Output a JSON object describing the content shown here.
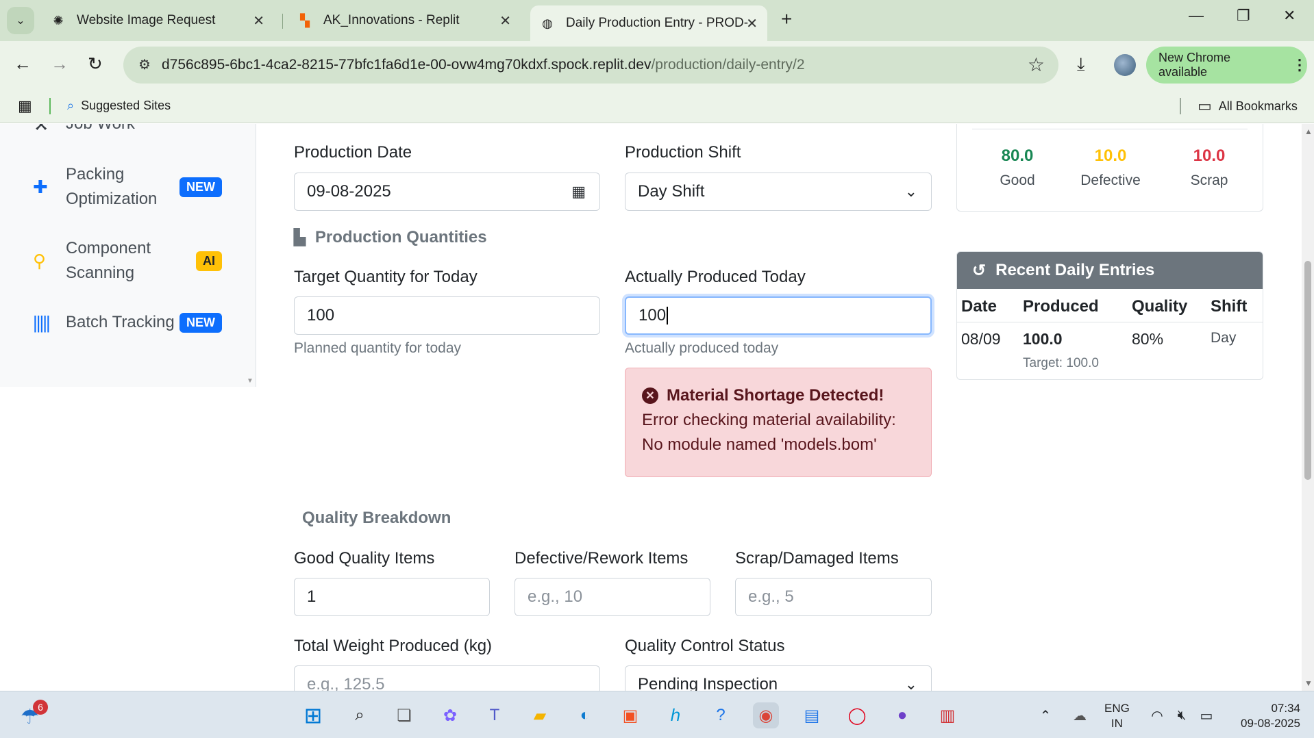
{
  "browser": {
    "tabs": [
      {
        "title": "Website Image Request",
        "favicon": "openai-icon"
      },
      {
        "title": "AK_Innovations - Replit",
        "favicon": "replit-icon"
      },
      {
        "title": "Daily Production Entry - PROD-",
        "favicon": "globe-icon"
      }
    ],
    "url_host": "d756c895-6bc1-4ca2-8215-77bfc1fa6d1e-00-ovw4mg70kdxf.spock.replit.dev",
    "url_path": "/production/daily-entry/2",
    "new_chrome": "New Chrome available",
    "bookmarks": {
      "suggested": "Suggested Sites",
      "all": "All Bookmarks"
    }
  },
  "sidebar": {
    "items": [
      {
        "label": "Job Work",
        "icon": "tools-icon"
      },
      {
        "label": "Packing Optimization",
        "badge": "NEW",
        "icon": "puzzle-icon",
        "color": "#0d6efd"
      },
      {
        "label": "Component Scanning",
        "badge": "AI",
        "icon": "search-icon",
        "color": "#ffc107"
      },
      {
        "label": "Batch Tracking",
        "badge": "NEW",
        "icon": "barcode-icon",
        "color": "#0d6efd"
      }
    ]
  },
  "form": {
    "production_date": {
      "label": "Production Date",
      "value": "09-08-2025"
    },
    "production_shift": {
      "label": "Production Shift",
      "value": "Day Shift"
    },
    "quantities_title": "Production Quantities",
    "target_qty": {
      "label": "Target Quantity for Today",
      "value": "100",
      "helper": "Planned quantity for today"
    },
    "actual_qty": {
      "label": "Actually Produced Today",
      "value": "100",
      "helper": "Actually produced today"
    },
    "alert": {
      "title": "Material Shortage Detected!",
      "body_line1": "Error checking material availability:",
      "body_line2": "No module named 'models.bom'"
    },
    "quality_title": "Quality Breakdown",
    "good_items": {
      "label": "Good Quality Items",
      "value": "1"
    },
    "defective_items": {
      "label": "Defective/Rework Items",
      "placeholder": "e.g., 10"
    },
    "scrap_items": {
      "label": "Scrap/Damaged Items",
      "placeholder": "e.g., 5"
    },
    "total_weight": {
      "label": "Total Weight Produced (kg)",
      "placeholder": "e.g., 125.5"
    },
    "qc_status": {
      "label": "Quality Control Status",
      "value": "Pending Inspection"
    }
  },
  "summary": {
    "good": {
      "value": "80.0",
      "label": "Good",
      "color": "#198754"
    },
    "defective": {
      "value": "10.0",
      "label": "Defective",
      "color": "#ffc107"
    },
    "scrap": {
      "value": "10.0",
      "label": "Scrap",
      "color": "#dc3545"
    }
  },
  "recent": {
    "title": "Recent Daily Entries",
    "headers": [
      "Date",
      "Produced",
      "Quality",
      "Shift"
    ],
    "rows": [
      {
        "date": "08/09",
        "produced": "100.0",
        "target": "Target: 100.0",
        "quality": "80%",
        "shift": "Day"
      }
    ]
  },
  "taskbar": {
    "weather_badge": "6",
    "lang_line1": "ENG",
    "lang_line2": "IN",
    "time": "07:34",
    "date": "09-08-2025"
  }
}
